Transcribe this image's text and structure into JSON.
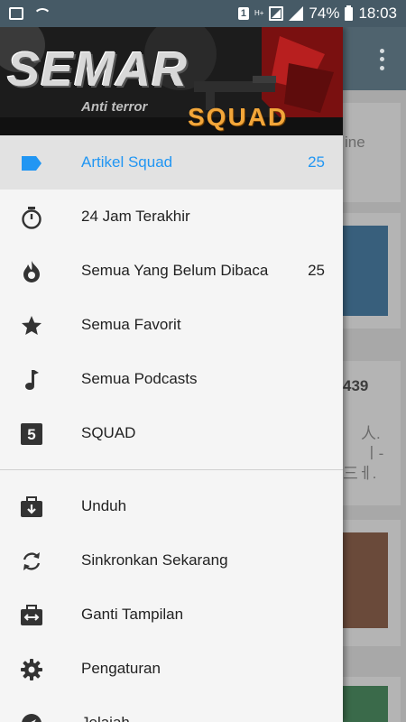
{
  "status_bar": {
    "battery": "74%",
    "time": "18:03",
    "sim_badge": "1",
    "network_type": "H+"
  },
  "header": {
    "title": "SEMAR",
    "subtitle": "Anti terror",
    "brand": "SQUAD"
  },
  "menu": [
    {
      "label": "Artikel Squad",
      "count": "25",
      "icon": "label-tag-icon",
      "active": true
    },
    {
      "label": "24 Jam Terakhir",
      "count": "",
      "icon": "timer-icon"
    },
    {
      "label": "Semua Yang Belum Dibaca",
      "count": "25",
      "icon": "flame-icon"
    },
    {
      "label": "Semua Favorit",
      "count": "",
      "icon": "star-icon"
    },
    {
      "label": "Semua Podcasts",
      "count": "",
      "icon": "music-note-icon"
    },
    {
      "label": "SQUAD",
      "count": "",
      "icon": "number-5-icon"
    }
  ],
  "secondary_menu": [
    {
      "label": "Unduh",
      "icon": "download-briefcase-icon"
    },
    {
      "label": "Sinkronkan Sekarang",
      "icon": "sync-icon"
    },
    {
      "label": "Ganti Tampilan",
      "icon": "swap-view-icon"
    },
    {
      "label": "Pengaturan",
      "icon": "gear-icon"
    },
    {
      "label": "Jelajah",
      "icon": "compass-icon"
    }
  ],
  "background": {
    "fragment_1": "ine",
    "fragment_2": "439",
    "fragment_3": "人.",
    "fragment_4": "ㅣ-",
    "fragment_5": "三ㅔ."
  },
  "colors": {
    "accent": "#2196f3",
    "status_bar": "#465a66",
    "toolbar": "#4f636e",
    "drawer_bg": "#f5f5f5",
    "active_row": "#e2e2e2",
    "squad_orange": "#f2a63a"
  }
}
